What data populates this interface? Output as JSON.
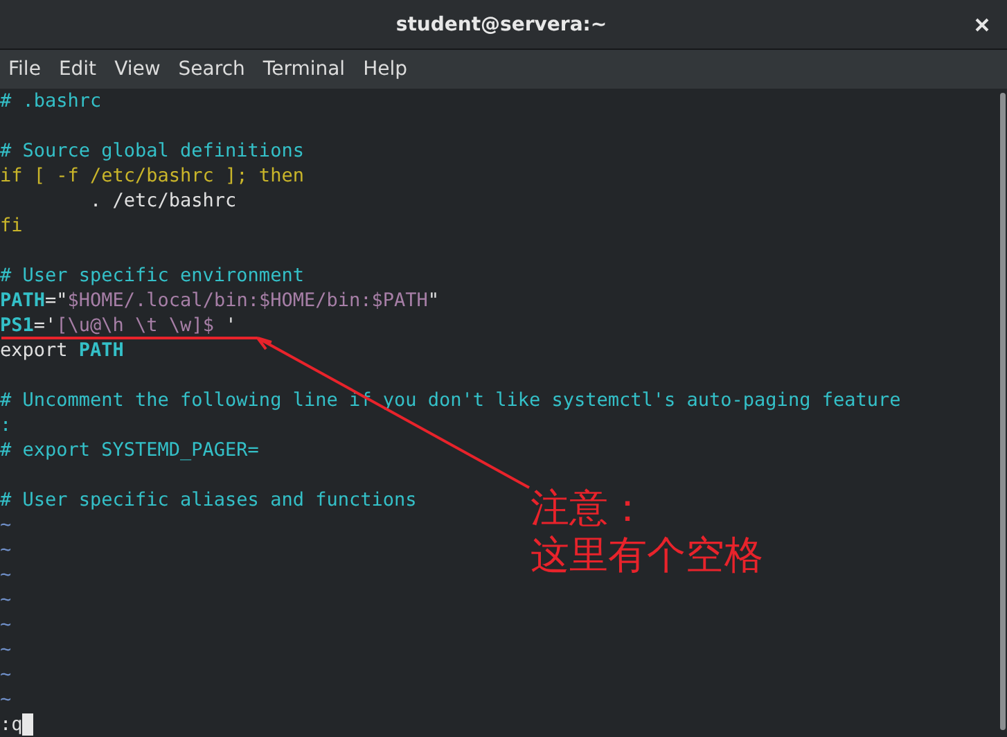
{
  "window": {
    "title": "student@servera:~"
  },
  "menu": [
    "File",
    "Edit",
    "View",
    "Search",
    "Terminal",
    "Help"
  ],
  "lines": [
    {
      "kind": "code",
      "tokens": [
        {
          "text": "# .bashrc",
          "kind": "comment"
        }
      ]
    },
    {
      "kind": "blank"
    },
    {
      "kind": "code",
      "tokens": [
        {
          "text": "# Source global definitions",
          "kind": "comment"
        }
      ]
    },
    {
      "kind": "code",
      "tokens": [
        {
          "text": "if [ -f /etc/bashrc ]; then",
          "kind": "keyword"
        }
      ]
    },
    {
      "kind": "code",
      "tokens": [
        {
          "text": "        . /etc/bashrc",
          "kind": "plain"
        }
      ]
    },
    {
      "kind": "code",
      "tokens": [
        {
          "text": "fi",
          "kind": "keyword"
        }
      ]
    },
    {
      "kind": "blank"
    },
    {
      "kind": "code",
      "tokens": [
        {
          "text": "# User specific environment",
          "kind": "comment"
        }
      ]
    },
    {
      "kind": "code",
      "tokens": [
        {
          "text": "PATH",
          "kind": "variable"
        },
        {
          "text": "=\"",
          "kind": "plain"
        },
        {
          "text": "$HOME/.local/bin:$HOME/bin:$PATH",
          "kind": "string"
        },
        {
          "text": "\"",
          "kind": "plain"
        }
      ]
    },
    {
      "kind": "code",
      "tokens": [
        {
          "text": "PS1",
          "kind": "variable"
        },
        {
          "text": "='",
          "kind": "plain"
        },
        {
          "text": "[\\u@\\h \\t \\w]$ ",
          "kind": "string"
        },
        {
          "text": "'",
          "kind": "plain"
        }
      ]
    },
    {
      "kind": "code",
      "tokens": [
        {
          "text": "export ",
          "kind": "plain"
        },
        {
          "text": "PATH",
          "kind": "variable"
        }
      ]
    },
    {
      "kind": "blank"
    },
    {
      "kind": "code",
      "tokens": [
        {
          "text": "# Uncomment the following line if you don't like systemctl's auto-paging feature",
          "kind": "comment"
        }
      ]
    },
    {
      "kind": "code",
      "tokens": [
        {
          "text": ":",
          "kind": "comment"
        }
      ]
    },
    {
      "kind": "code",
      "tokens": [
        {
          "text": "# export SYSTEMD_PAGER=",
          "kind": "comment"
        }
      ]
    },
    {
      "kind": "blank"
    },
    {
      "kind": "code",
      "tokens": [
        {
          "text": "# User specific aliases and functions",
          "kind": "comment"
        }
      ]
    },
    {
      "kind": "code",
      "tokens": [
        {
          "text": "~",
          "kind": "tilde"
        }
      ]
    },
    {
      "kind": "code",
      "tokens": [
        {
          "text": "~",
          "kind": "tilde"
        }
      ]
    },
    {
      "kind": "code",
      "tokens": [
        {
          "text": "~",
          "kind": "tilde"
        }
      ]
    },
    {
      "kind": "code",
      "tokens": [
        {
          "text": "~",
          "kind": "tilde"
        }
      ]
    },
    {
      "kind": "code",
      "tokens": [
        {
          "text": "~",
          "kind": "tilde"
        }
      ]
    },
    {
      "kind": "code",
      "tokens": [
        {
          "text": "~",
          "kind": "tilde"
        }
      ]
    },
    {
      "kind": "code",
      "tokens": [
        {
          "text": "~",
          "kind": "tilde"
        }
      ]
    },
    {
      "kind": "code",
      "tokens": [
        {
          "text": "~",
          "kind": "tilde"
        }
      ]
    }
  ],
  "command_line": {
    "value": ":q"
  },
  "annotation": {
    "lines": [
      "注意：",
      "这里有个空格"
    ]
  }
}
